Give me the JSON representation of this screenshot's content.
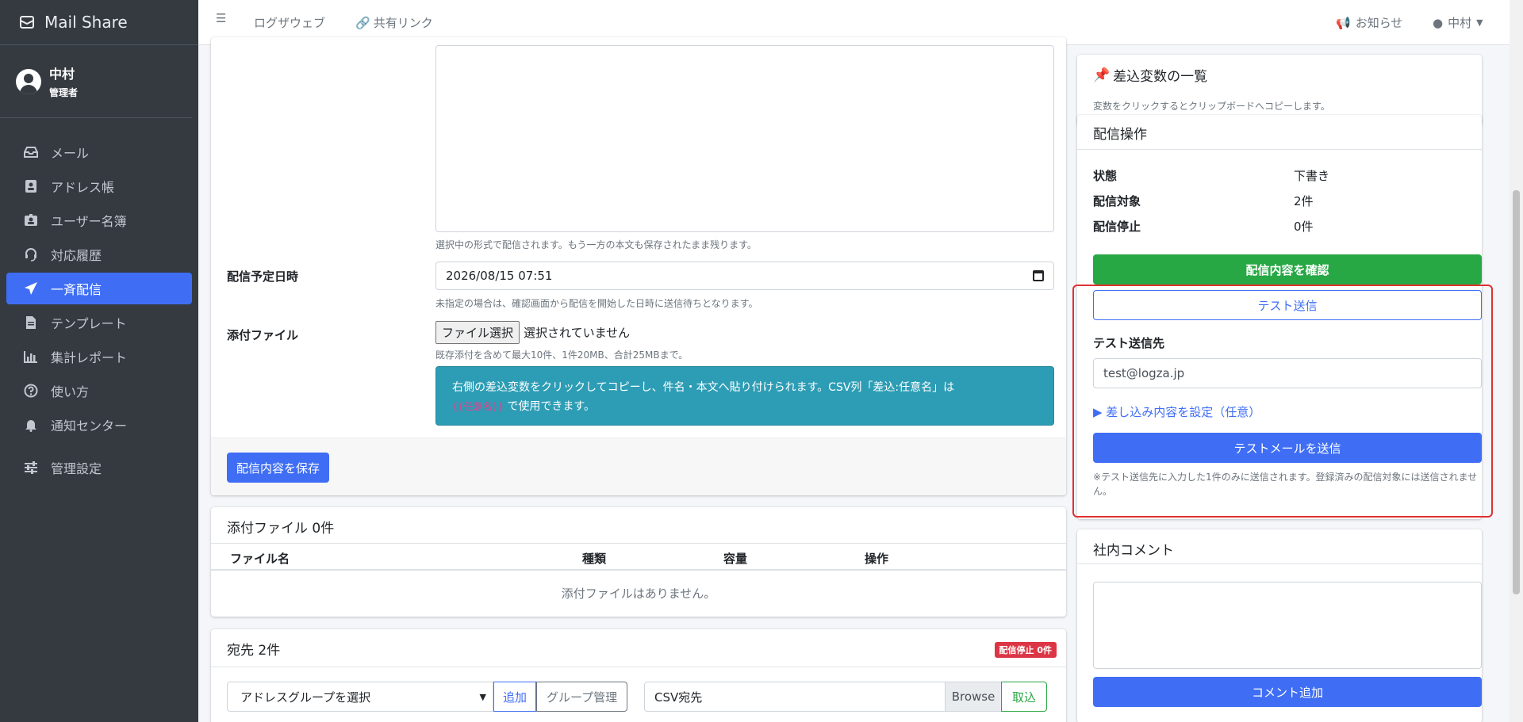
{
  "app": {
    "name": "Mail Share"
  },
  "user": {
    "name": "中村",
    "role": "管理者"
  },
  "sidebar": {
    "items": [
      {
        "label": "メール",
        "icon": "inbox-icon"
      },
      {
        "label": "アドレス帳",
        "icon": "address-book-icon"
      },
      {
        "label": "ユーザー名簿",
        "icon": "id-badge-icon"
      },
      {
        "label": "対応履歴",
        "icon": "headset-icon"
      },
      {
        "label": "一斉配信",
        "icon": "paper-plane-icon",
        "active": true
      },
      {
        "label": "テンプレート",
        "icon": "file-icon"
      },
      {
        "label": "集計レポート",
        "icon": "bar-chart-icon"
      },
      {
        "label": "使い方",
        "icon": "question-circle-icon"
      },
      {
        "label": "通知センター",
        "icon": "bell-icon"
      },
      {
        "label": "管理設定",
        "icon": "sliders-icon"
      }
    ]
  },
  "topbar": {
    "links": [
      "ログザウェブ",
      "共有リンク"
    ],
    "notice": "お知らせ",
    "user": "中村"
  },
  "form": {
    "body_help": "選択中の形式で配信されます。もう一方の本文も保存されたまま残ります。",
    "schedule_label": "配信予定日時",
    "schedule_value": "2026/08/15 07:51",
    "schedule_help": "未指定の場合は、確認画面から配信を開始した日時に送信待ちとなります。",
    "attach_label": "添付ファイル",
    "file_button": "ファイル選択",
    "file_none": "選択されていません",
    "attach_help": "既存添付を含めて最大10件、1件20MB、合計25MBまで。",
    "callout_text": "右側の差込変数をクリックしてコピーし、件名・本文へ貼り付けられます。CSV列「差込:任意名」は",
    "callout_code": "{{任意名}}",
    "callout_tail": "で使用できます。",
    "save_button": "配信内容を保存"
  },
  "attachments": {
    "title": "添付ファイル 0件",
    "columns": [
      "ファイル名",
      "種類",
      "容量",
      "操作"
    ],
    "empty": "添付ファイルはありません。"
  },
  "destinations": {
    "title": "宛先 2件",
    "badge": "配信停止 0件",
    "group_select": "アドレスグループを選択",
    "add_button": "追加",
    "group_manage": "グループ管理",
    "csv_label": "CSV宛先",
    "browse": "Browse",
    "import": "取込"
  },
  "vars": {
    "title": "差込変数の一覧",
    "desc": "変数をクリックするとクリップボードへコピーします。"
  },
  "ops": {
    "title": "配信操作",
    "rows": [
      {
        "key": "状態",
        "value": "下書き"
      },
      {
        "key": "配信対象",
        "value": "2件"
      },
      {
        "key": "配信停止",
        "value": "0件"
      }
    ],
    "confirm_button": "配信内容を確認",
    "test_send_button": "テスト送信",
    "test_dest_label": "テスト送信先",
    "test_dest_value": "test@logza.jp",
    "merge_toggle": "▶ 差し込み内容を設定（任意）",
    "test_mail_button": "テストメールを送信",
    "test_note": "※テスト送信先に入力した1件のみに送信されます。登録済みの配信対象には送信されません。"
  },
  "comment": {
    "title": "社内コメント",
    "button": "コメント追加"
  },
  "colors": {
    "primary": "#3f6ef5",
    "success": "#28a745",
    "danger": "#dc3545",
    "info": "#2d9db5",
    "sidebar": "#343a40"
  }
}
